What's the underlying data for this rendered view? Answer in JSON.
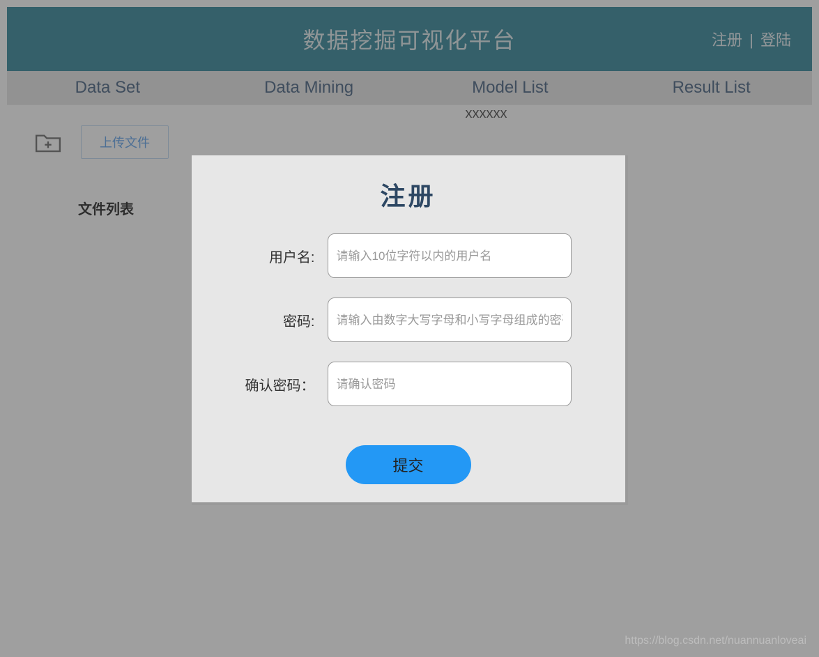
{
  "header": {
    "title": "数据挖掘可视化平台",
    "register_link": "注册",
    "login_link": "登陆",
    "separator": "|"
  },
  "nav": {
    "items": [
      {
        "label": "Data Set"
      },
      {
        "label": "Data Mining"
      },
      {
        "label": "Model List"
      },
      {
        "label": "Result List"
      }
    ]
  },
  "content": {
    "upload_button": "上传文件",
    "file_list_heading": "文件列表",
    "placeholder_text": "xxxxxx"
  },
  "modal": {
    "title": "注册",
    "fields": {
      "username": {
        "label": "用户名:",
        "placeholder": "请输入10位字符以内的用户名"
      },
      "password": {
        "label": "密码:",
        "placeholder": "请输入由数字大写字母和小写字母组成的密码"
      },
      "confirm": {
        "label": "确认密码：",
        "placeholder": "请确认密码"
      }
    },
    "submit_label": "提交"
  },
  "watermark": "https://blog.csdn.net/nuannuanloveai"
}
